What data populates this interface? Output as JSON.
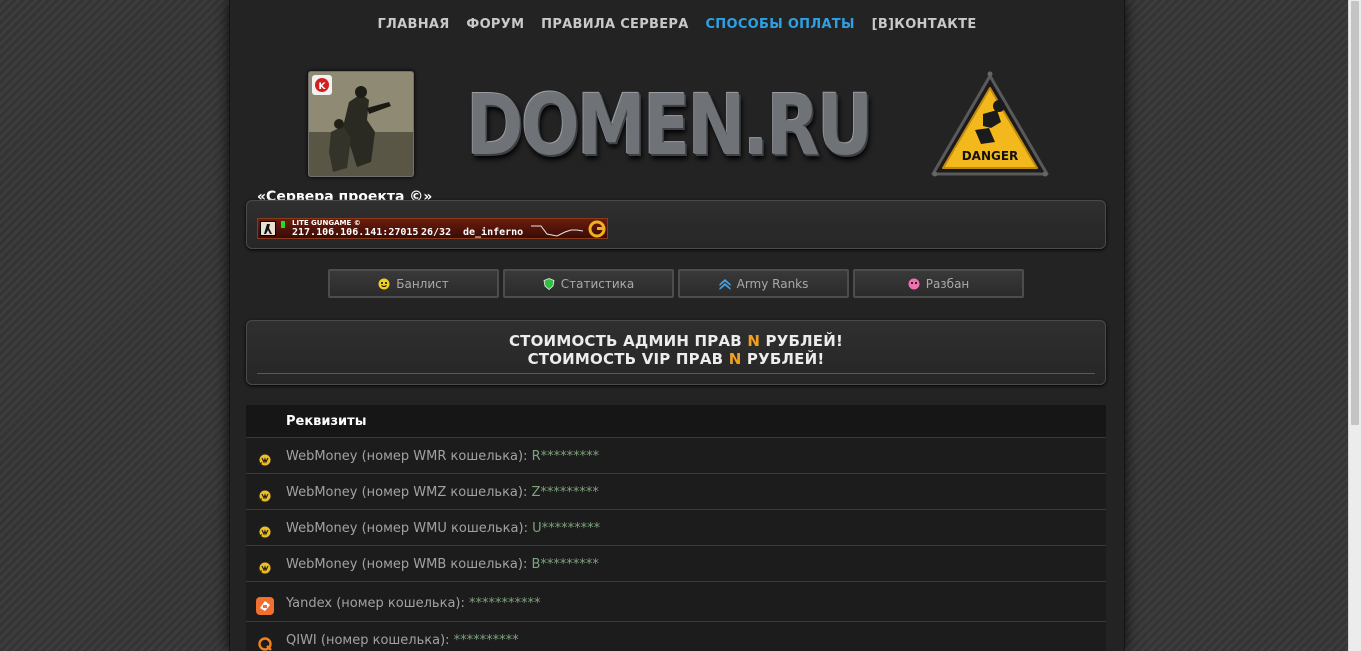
{
  "nav": {
    "items": [
      {
        "label": "ГЛАВНАЯ",
        "active": false
      },
      {
        "label": "ФОРУМ",
        "active": false
      },
      {
        "label": "ПРАВИЛА СЕРВЕРА",
        "active": false
      },
      {
        "label": "СПОСОБЫ ОПЛАТЫ",
        "active": true
      },
      {
        "label": "[В]КОНТАКТЕ",
        "active": false
      }
    ]
  },
  "header": {
    "logo_text": "DOMEN.RU",
    "danger_text": "DANGER"
  },
  "servers": {
    "title": "«Сервера проекта ©»",
    "banner": {
      "name": "LITE GUNGAME ©",
      "address": "217.106.106.141:27015",
      "players": "26/32",
      "map": "de_inferno"
    }
  },
  "tabs": [
    {
      "label": "Банлист",
      "icon": "smiley-icon"
    },
    {
      "label": "Статистика",
      "icon": "shield-icon"
    },
    {
      "label": "Army Ranks",
      "icon": "rank-chevron-icon"
    },
    {
      "label": "Разбан",
      "icon": "pink-smiley-icon"
    }
  ],
  "prices": {
    "admin_prefix": "СТОИМОСТЬ АДМИН ПРАВ ",
    "admin_n": "N",
    "admin_suffix": " РУБЛЕЙ!",
    "vip_prefix": "СТОИМОСТЬ VIP ПРАВ ",
    "vip_n": "N",
    "vip_suffix": " РУБЛЕЙ!"
  },
  "requisites": {
    "title": "Реквизиты",
    "rows": [
      {
        "label": "WebMoney (номер WMR кошелька):",
        "value": " R*********",
        "icon": "webmoney-icon"
      },
      {
        "label": "WebMoney (номер WMZ кошелька):",
        "value": " Z*********",
        "icon": "webmoney-icon"
      },
      {
        "label": "WebMoney (номер WMU кошелька):",
        "value": " U*********",
        "icon": "webmoney-icon"
      },
      {
        "label": "WebMoney (номер WMB кошелька):",
        "value": " B*********",
        "icon": "webmoney-icon"
      },
      {
        "label": "Yandex (номер кошелька):",
        "value": " ***********",
        "icon": "yandex-money-icon"
      },
      {
        "label": "QIWI (номер кошелька):",
        "value": " **********",
        "icon": "qiwi-icon"
      }
    ]
  },
  "colors": {
    "accent": "#2ea0e6",
    "price_highlight": "#f0a020"
  }
}
